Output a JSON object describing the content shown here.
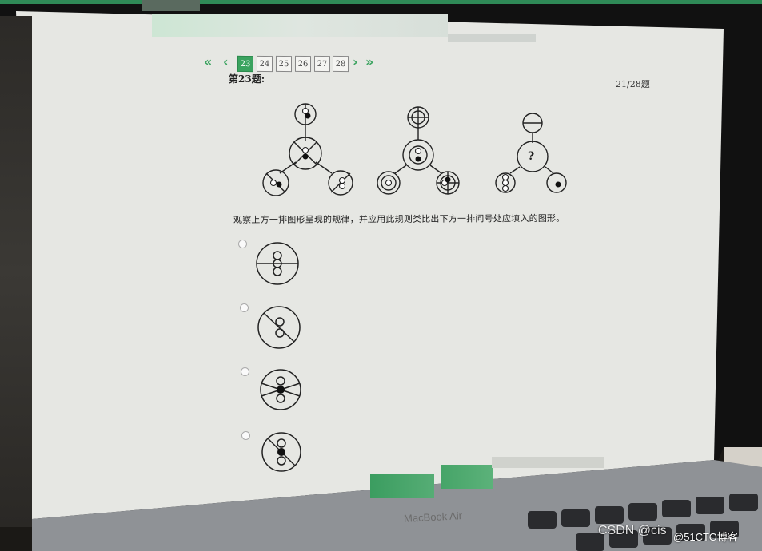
{
  "pager": {
    "first_icon": "double-chevron-left-icon",
    "prev_icon": "chevron-left-icon",
    "pages": [
      "23",
      "24",
      "25",
      "26",
      "27",
      "28"
    ],
    "active_page": "23",
    "next_icon": "chevron-right-icon",
    "last_icon": "double-chevron-right-icon"
  },
  "question": {
    "title": "第23题:",
    "progress": "21/28题",
    "prompt": "观察上方一排图形呈现的规律，并应用此规则类比出下方一排问号处应填入的图形。",
    "unknown_mark": "?"
  },
  "laptop": {
    "brand": "MacBook Air"
  },
  "watermark": {
    "site": "CSDN @cis",
    "blog": "@51CTO博客"
  },
  "colors": {
    "accent": "#3aa35f",
    "screen": "#e8e9e6"
  }
}
